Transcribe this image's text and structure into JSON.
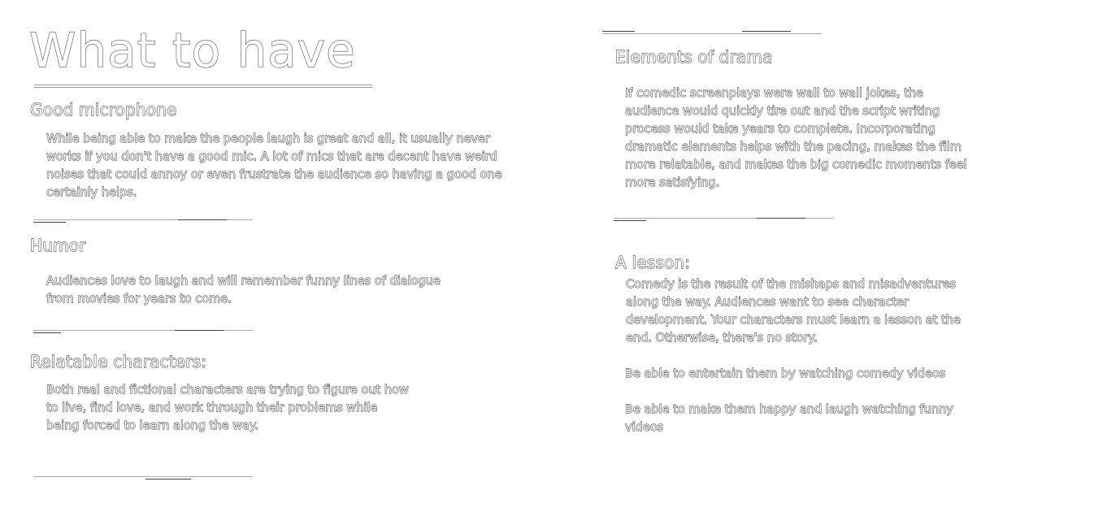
{
  "title": "What to have",
  "left": {
    "sections": [
      {
        "heading": "Good microphone",
        "body": "While being able to make the people laugh is great and all, it usually never works if you don't have a good mic. A lot of mics that are decent have weird noises that could annoy or even frustrate the audience so having a good one certainly helps."
      },
      {
        "heading": "Humor",
        "body": "Audiences love to laugh and will remember funny lines of dialogue from movies for years to come."
      },
      {
        "heading": "Relatable characters:",
        "body": "Both real and fictional characters are trying to figure out how to live, find love, and work through their problems while being forced to learn along the way."
      }
    ]
  },
  "right": {
    "sections": [
      {
        "heading": "Elements of drama",
        "body": "If comedic screenplays were wall to wall jokes, the audience would quickly tire out and the script writing process would take years to complete. Incorporating dramatic elements helps with the pacing, makes the film more relatable, and makes the big comedic moments feel more satisfying."
      },
      {
        "heading": "A lesson:",
        "body": "Comedy is the result of the mishaps and misadventures along the way. Audiences want to see character development. Your characters must learn a lesson at the end. Otherwise, there's no story."
      }
    ],
    "goals": [
      "Be able to entertain them by watching comedy videos",
      "Be able to make them happy and laugh watching funny videos"
    ]
  }
}
